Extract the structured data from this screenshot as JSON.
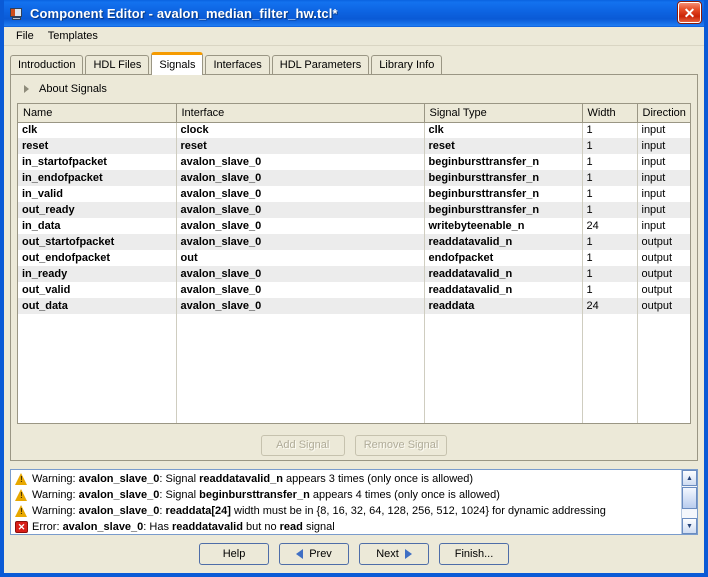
{
  "window": {
    "title": "Component Editor - avalon_median_filter_hw.tcl*",
    "app_icon": "component-editor-icon",
    "close_label": "✕"
  },
  "menu": {
    "items": [
      {
        "label": "File"
      },
      {
        "label": "Templates"
      }
    ]
  },
  "tabs": [
    {
      "label": "Introduction",
      "active": false
    },
    {
      "label": "HDL Files",
      "active": false
    },
    {
      "label": "Signals",
      "active": true
    },
    {
      "label": "Interfaces",
      "active": false
    },
    {
      "label": "HDL Parameters",
      "active": false
    },
    {
      "label": "Library Info",
      "active": false
    }
  ],
  "about": {
    "label": "About Signals",
    "expanded": false,
    "toggle_icon": "chevron-right-icon"
  },
  "table": {
    "columns": [
      "Name",
      "Interface",
      "Signal Type",
      "Width",
      "Direction"
    ],
    "rows": [
      {
        "name": "clk",
        "interface": "clock",
        "signal_type": "clk",
        "width": "1",
        "direction": "input"
      },
      {
        "name": "reset",
        "interface": "reset",
        "signal_type": "reset",
        "width": "1",
        "direction": "input"
      },
      {
        "name": "in_startofpacket",
        "interface": "avalon_slave_0",
        "signal_type": "beginbursttransfer_n",
        "width": "1",
        "direction": "input"
      },
      {
        "name": "in_endofpacket",
        "interface": "avalon_slave_0",
        "signal_type": "beginbursttransfer_n",
        "width": "1",
        "direction": "input"
      },
      {
        "name": "in_valid",
        "interface": "avalon_slave_0",
        "signal_type": "beginbursttransfer_n",
        "width": "1",
        "direction": "input"
      },
      {
        "name": "out_ready",
        "interface": "avalon_slave_0",
        "signal_type": "beginbursttransfer_n",
        "width": "1",
        "direction": "input"
      },
      {
        "name": "in_data",
        "interface": "avalon_slave_0",
        "signal_type": "writebyteenable_n",
        "width": "24",
        "direction": "input"
      },
      {
        "name": "out_startofpacket",
        "interface": "avalon_slave_0",
        "signal_type": "readdatavalid_n",
        "width": "1",
        "direction": "output"
      },
      {
        "name": "out_endofpacket",
        "interface": "out",
        "signal_type": "endofpacket",
        "width": "1",
        "direction": "output"
      },
      {
        "name": "in_ready",
        "interface": "avalon_slave_0",
        "signal_type": "readdatavalid_n",
        "width": "1",
        "direction": "output"
      },
      {
        "name": "out_valid",
        "interface": "avalon_slave_0",
        "signal_type": "readdatavalid_n",
        "width": "1",
        "direction": "output"
      },
      {
        "name": "out_data",
        "interface": "avalon_slave_0",
        "signal_type": "readdata",
        "width": "24",
        "direction": "output"
      }
    ]
  },
  "signal_buttons": {
    "add_label": "Add Signal",
    "remove_label": "Remove Signal",
    "add_enabled": false,
    "remove_enabled": false
  },
  "messages": [
    {
      "severity": "warning",
      "icon": "warning-triangle-icon",
      "parts": [
        {
          "t": "Warning: ",
          "b": false
        },
        {
          "t": "avalon_slave_0",
          "b": true
        },
        {
          "t": ": Signal ",
          "b": false
        },
        {
          "t": "readdatavalid_n",
          "b": true
        },
        {
          "t": " appears 3 times (only once is allowed)",
          "b": false
        }
      ]
    },
    {
      "severity": "warning",
      "icon": "warning-triangle-icon",
      "parts": [
        {
          "t": "Warning: ",
          "b": false
        },
        {
          "t": "avalon_slave_0",
          "b": true
        },
        {
          "t": ": Signal ",
          "b": false
        },
        {
          "t": "beginbursttransfer_n",
          "b": true
        },
        {
          "t": " appears 4 times (only once is allowed)",
          "b": false
        }
      ]
    },
    {
      "severity": "warning",
      "icon": "warning-triangle-icon",
      "parts": [
        {
          "t": "Warning: ",
          "b": false
        },
        {
          "t": "avalon_slave_0",
          "b": true
        },
        {
          "t": ": ",
          "b": false
        },
        {
          "t": "readdata[24]",
          "b": true
        },
        {
          "t": " width must be in {8, 16, 32, 64, 128, 256, 512, 1024} for dynamic addressing",
          "b": false
        }
      ]
    },
    {
      "severity": "error",
      "icon": "error-x-icon",
      "parts": [
        {
          "t": "Error: ",
          "b": false
        },
        {
          "t": "avalon_slave_0",
          "b": true
        },
        {
          "t": ": Has ",
          "b": false
        },
        {
          "t": "readdatavalid",
          "b": true
        },
        {
          "t": " but no ",
          "b": false
        },
        {
          "t": "read",
          "b": true
        },
        {
          "t": " signal",
          "b": false
        }
      ]
    }
  ],
  "scrollbar": {
    "up_glyph": "▲",
    "down_glyph": "▼"
  },
  "footer_buttons": [
    {
      "label": "Help",
      "icon": null
    },
    {
      "label": "Prev",
      "icon": "arrow-left-icon"
    },
    {
      "label": "Next",
      "icon": "arrow-right-icon"
    },
    {
      "label": "Finish...",
      "icon": null
    }
  ],
  "colors": {
    "titlebar": "#0a5ad6",
    "accent_tab": "#f59b00",
    "panel": "#ece9d8",
    "warning": "#e8a800",
    "error": "#d91e18"
  }
}
